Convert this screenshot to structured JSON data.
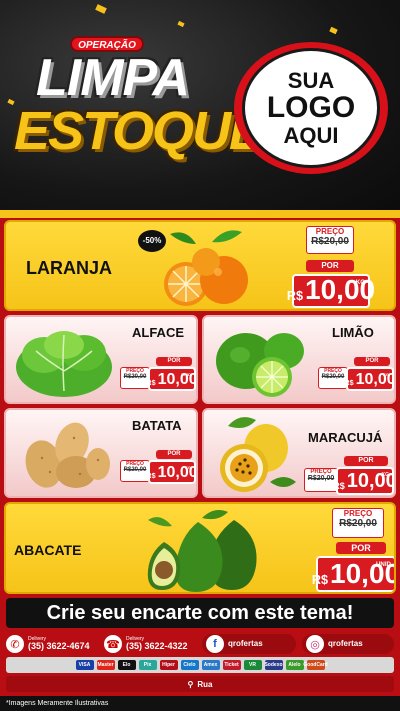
{
  "header": {
    "badge": "OPERAÇÃO",
    "title_line1": "LIMPA",
    "title_line2": "ESTOQUE",
    "logo_line1": "SUA",
    "logo_line2": "LOGO",
    "logo_line3": "AQUI"
  },
  "labels": {
    "preco": "PREÇO",
    "por": "POR",
    "currency": "R$"
  },
  "products": [
    {
      "name": "LARANJA",
      "old_price": "R$20,00",
      "price": "10,00",
      "unit": "KG",
      "discount": "-50%"
    },
    {
      "name": "ALFACE",
      "old_price": "R$20,00",
      "price": "10,00",
      "unit": "UNID"
    },
    {
      "name": "LIMÃO",
      "old_price": "R$20,00",
      "price": "10,00",
      "unit": "KG"
    },
    {
      "name": "BATATA",
      "old_price": "R$20,00",
      "price": "10,00",
      "unit": "KG"
    },
    {
      "name": "MARACUJÁ",
      "old_price": "R$20,00",
      "price": "10,00",
      "unit": "KG"
    },
    {
      "name": "ABACATE",
      "old_price": "R$20,00",
      "price": "10,00",
      "unit": "UNID"
    }
  ],
  "footer": {
    "cta": "Crie seu encarte com este tema!",
    "delivery_label": "Delivery",
    "phone1": "(35) 3622-4674",
    "phone2": "(35) 3622-4322",
    "facebook": "qrofertas",
    "instagram": "qrofertas",
    "payments": [
      "VISA",
      "Master",
      "Elo",
      "Pix",
      "Hiper",
      "Cielo",
      "Amex",
      "Ticket",
      "VR",
      "Sodexo",
      "Alelo",
      "GoodCard"
    ],
    "address": "Rua",
    "disclaimer": "*Imagens Meramente Ilustrativas"
  },
  "colors": {
    "brand_red": "#d71b20",
    "brand_yellow": "#f6c419",
    "dark": "#111111"
  }
}
